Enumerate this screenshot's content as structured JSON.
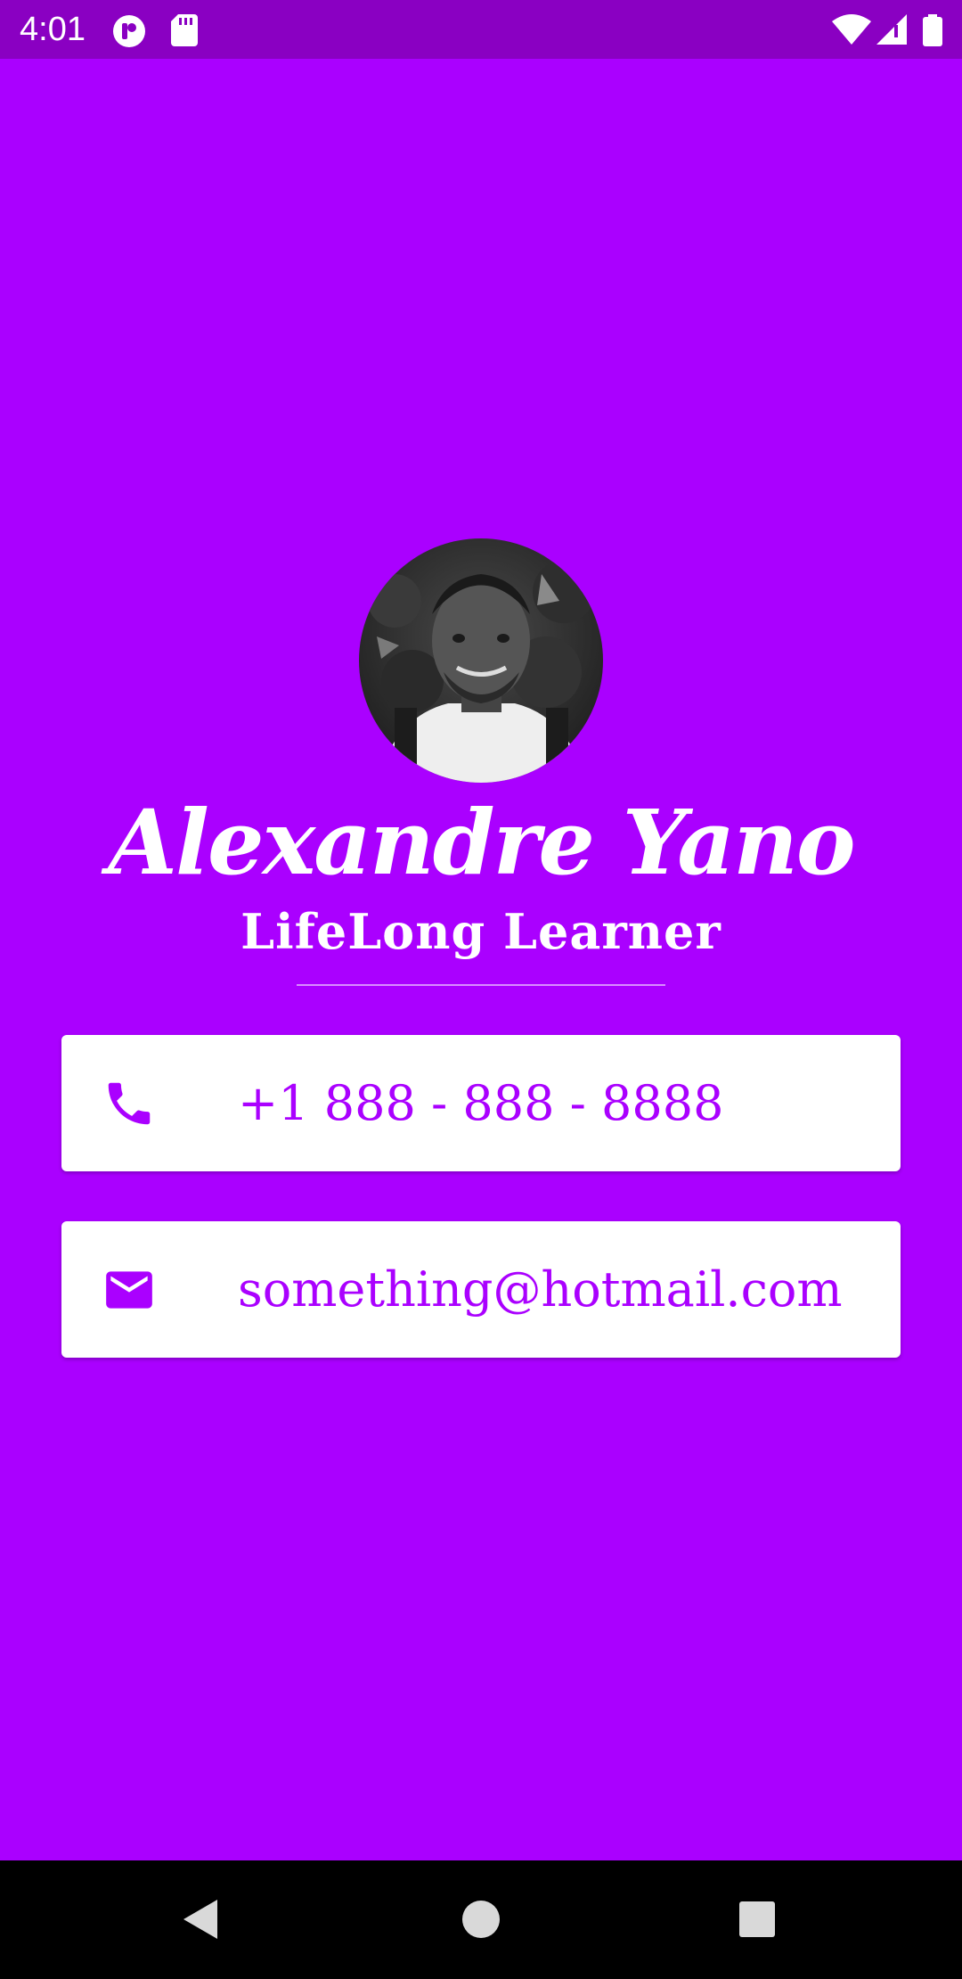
{
  "status_bar": {
    "time": "4:01",
    "icons": [
      "notification-app-icon",
      "sd-card-icon",
      "wifi-icon",
      "cellular-signal-icon",
      "battery-icon"
    ]
  },
  "profile": {
    "avatar_alt": "profile photo",
    "name": "Alexandre Yano",
    "subtitle": "LifeLong Learner"
  },
  "contacts": {
    "phone": {
      "icon": "phone-icon",
      "value": "+1 888 - 888 - 8888"
    },
    "email": {
      "icon": "email-icon",
      "value": "something@hotmail.com"
    }
  },
  "nav_bar": {
    "buttons": [
      "back-icon",
      "home-icon",
      "recents-icon"
    ]
  },
  "colors": {
    "background": "#aa00ff",
    "status_bar": "#8a00c2",
    "card": "#ffffff",
    "accent_text": "#aa00ff"
  }
}
